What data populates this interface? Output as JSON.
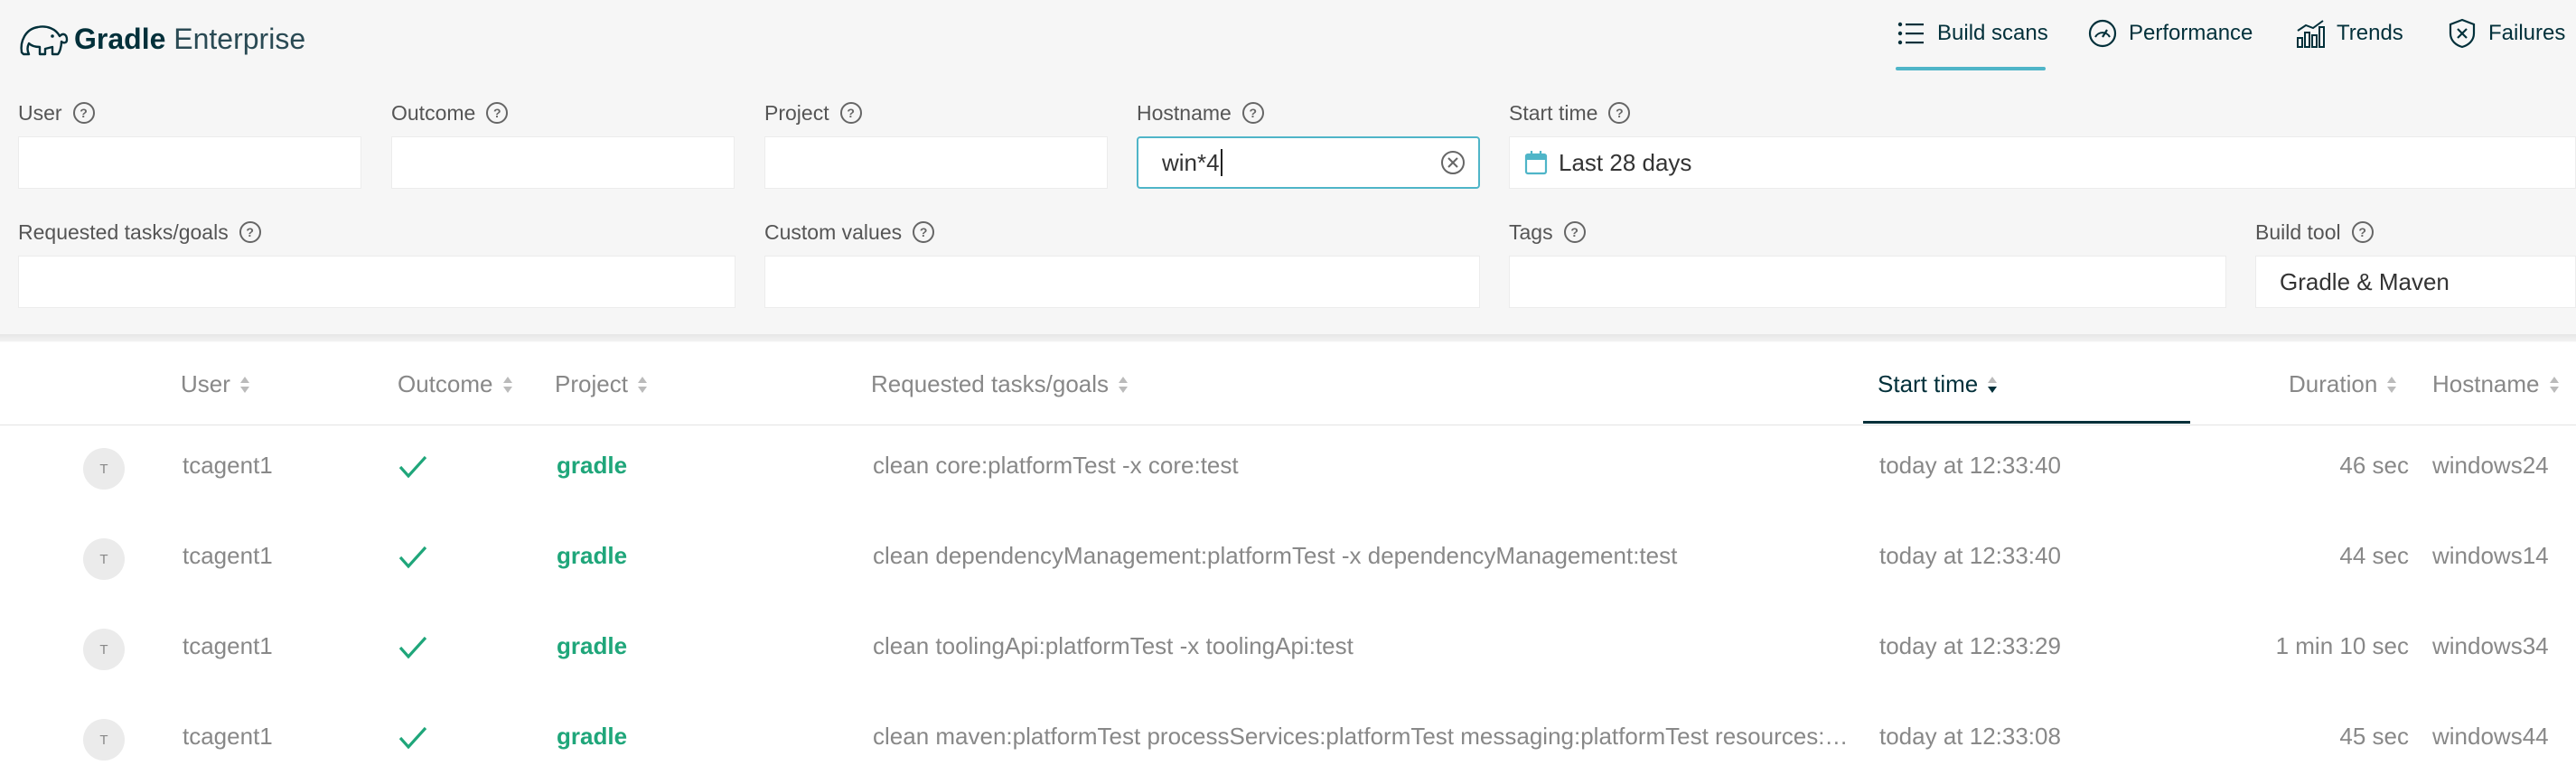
{
  "app": {
    "brand_bold": "Gradle",
    "brand_light": " Enterprise"
  },
  "nav": [
    {
      "label": "Build scans",
      "icon": "list-icon",
      "active": true
    },
    {
      "label": "Performance",
      "icon": "gauge-icon",
      "active": false
    },
    {
      "label": "Trends",
      "icon": "bar-chart-icon",
      "active": false
    },
    {
      "label": "Failures",
      "icon": "failure-shield-icon",
      "active": false
    }
  ],
  "filters": {
    "user": {
      "label": "User",
      "value": ""
    },
    "outcome": {
      "label": "Outcome",
      "value": ""
    },
    "project": {
      "label": "Project",
      "value": ""
    },
    "hostname": {
      "label": "Hostname",
      "value": "win*4"
    },
    "start_time": {
      "label": "Start time",
      "value": "Last 28 days"
    },
    "requested": {
      "label": "Requested tasks/goals",
      "value": ""
    },
    "custom_values": {
      "label": "Custom values",
      "value": ""
    },
    "tags": {
      "label": "Tags",
      "value": ""
    },
    "build_tool": {
      "label": "Build tool",
      "value": "Gradle & Maven"
    }
  },
  "table": {
    "columns": [
      "User",
      "Outcome",
      "Project",
      "Requested tasks/goals",
      "Start time",
      "Duration",
      "Hostname"
    ],
    "sorted_column": "Start time",
    "rows": [
      {
        "avatar": "T",
        "user": "tcagent1",
        "outcome": "success",
        "project": "gradle",
        "requested": "clean core:platformTest -x core:test",
        "start_time": "today at 12:33:40",
        "duration": "46 sec",
        "hostname": "windows24"
      },
      {
        "avatar": "T",
        "user": "tcagent1",
        "outcome": "success",
        "project": "gradle",
        "requested": "clean dependencyManagement:platformTest -x dependencyManagement:test",
        "start_time": "today at 12:33:40",
        "duration": "44 sec",
        "hostname": "windows14"
      },
      {
        "avatar": "T",
        "user": "tcagent1",
        "outcome": "success",
        "project": "gradle",
        "requested": "clean toolingApi:platformTest -x toolingApi:test",
        "start_time": "today at 12:33:29",
        "duration": "1 min 10 sec",
        "hostname": "windows34"
      },
      {
        "avatar": "T",
        "user": "tcagent1",
        "outcome": "success",
        "project": "gradle",
        "requested": "clean maven:platformTest processServices:platformTest messaging:platformTest resources:…",
        "start_time": "today at 12:33:08",
        "duration": "45 sec",
        "hostname": "windows44"
      }
    ]
  },
  "colors": {
    "accent": "#4fb5c8",
    "brand_dark": "#02303a",
    "project_green": "#1fa67a",
    "success_check": "#1fa67a"
  }
}
